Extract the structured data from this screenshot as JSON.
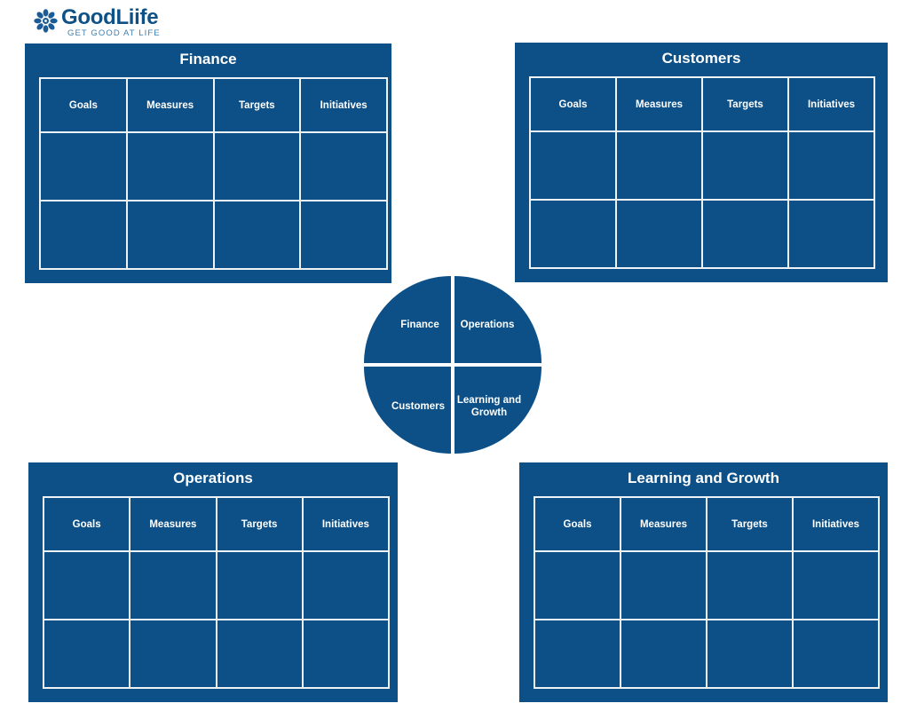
{
  "brand": {
    "name": "GoodLiife",
    "tagline": "GET GOOD AT LIFE",
    "mark_icon": "flower-asterisk-icon",
    "color": "#0d5186",
    "tagline_color": "#3d7fae"
  },
  "theme": {
    "panel_background": "#0c5087",
    "grid_line": "#eef2f5",
    "page_background": "#ffffff",
    "text_on_panel": "#ffffff"
  },
  "columns": [
    "Goals",
    "Measures",
    "Targets",
    "Initiatives"
  ],
  "panels": [
    {
      "id": "finance",
      "title": "Finance",
      "columns": [
        "Goals",
        "Measures",
        "Targets",
        "Initiatives"
      ],
      "rows": [
        [
          "",
          "",
          "",
          ""
        ],
        [
          "",
          "",
          "",
          ""
        ]
      ]
    },
    {
      "id": "customers",
      "title": "Customers",
      "columns": [
        "Goals",
        "Measures",
        "Targets",
        "Initiatives"
      ],
      "rows": [
        [
          "",
          "",
          "",
          ""
        ],
        [
          "",
          "",
          "",
          ""
        ]
      ]
    },
    {
      "id": "operations",
      "title": "Operations",
      "columns": [
        "Goals",
        "Measures",
        "Targets",
        "Initiatives"
      ],
      "rows": [
        [
          "",
          "",
          "",
          ""
        ],
        [
          "",
          "",
          "",
          ""
        ]
      ]
    },
    {
      "id": "learning",
      "title": "Learning and Growth",
      "columns": [
        "Goals",
        "Measures",
        "Targets",
        "Initiatives"
      ],
      "rows": [
        [
          "",
          "",
          "",
          ""
        ],
        [
          "",
          "",
          "",
          ""
        ]
      ]
    }
  ],
  "center_wheel": {
    "quadrants": [
      {
        "id": "finance",
        "label": "Finance",
        "position": "top-left"
      },
      {
        "id": "operations",
        "label": "Operations",
        "position": "top-right"
      },
      {
        "id": "customers",
        "label": "Customers",
        "position": "bottom-left"
      },
      {
        "id": "learning",
        "label": "Learning and Growth",
        "position": "bottom-right"
      }
    ]
  }
}
